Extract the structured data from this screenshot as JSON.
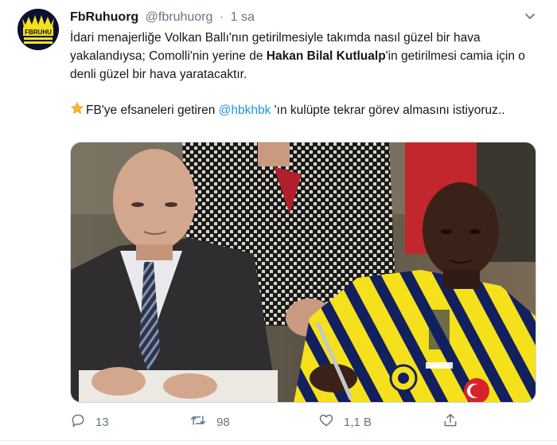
{
  "tweet": {
    "display_name": "FbRuhuorg",
    "handle": "@fbruhuorg",
    "separator": "·",
    "time": "1 sa",
    "avatar_text": "FBRUHU",
    "line1_pre": "İdari menajerliğe Volkan Ballı'nın getirilmesiyle takımda nasıl güzel bir hava yakalandıysa; Comolli'nin yerine de ",
    "line1_bold": "Hakan Bilal Kutlualp",
    "line1_post": "'in getirilmesi camia için o denli güzel bir hava yaratacaktır.",
    "line2_pre": "FB'ye efsaneleri getiren ",
    "line2_mention": "@hbkhbk",
    "line2_post": " 'ın kulüpte tekrar görev almasını istiyoruz.."
  },
  "actions": {
    "reply_count": "13",
    "retweet_count": "98",
    "like_count": "1,1 B"
  },
  "colors": {
    "accent": "#1b95e0",
    "muted": "#657786",
    "fb_yellow": "#f4e11b",
    "fb_navy": "#13205f"
  }
}
